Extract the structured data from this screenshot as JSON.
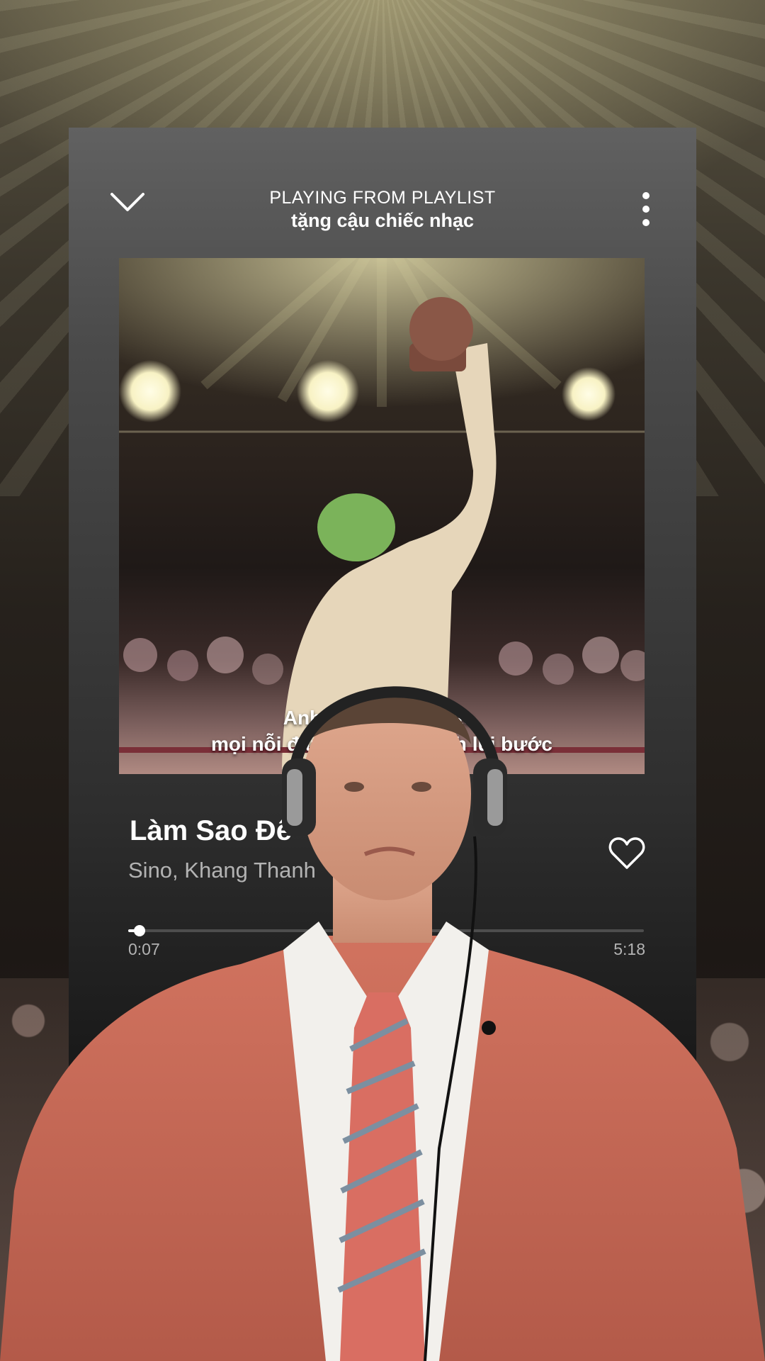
{
  "header": {
    "context_label": "PLAYING FROM PLAYLIST",
    "playlist_name": "tặng cậu chiếc nhạc"
  },
  "lyrics": {
    "line1": "Anh từng là ánh sao,",
    "line2": "mọi nỗi đau chẳng làm anh lùi bước"
  },
  "track": {
    "title": "Làm Sao Để",
    "artists": "Sino, Khang Thanh",
    "liked": false
  },
  "playback": {
    "elapsed": "0:07",
    "total": "5:18",
    "progress_fraction": 0.0225
  },
  "icons": {
    "collapse": "chevron-down-icon",
    "menu": "more-vertical-icon",
    "like": "heart-icon"
  },
  "colors": {
    "text_primary": "#ffffff",
    "text_secondary": "#b3b3b3",
    "suit": "#c46757"
  }
}
